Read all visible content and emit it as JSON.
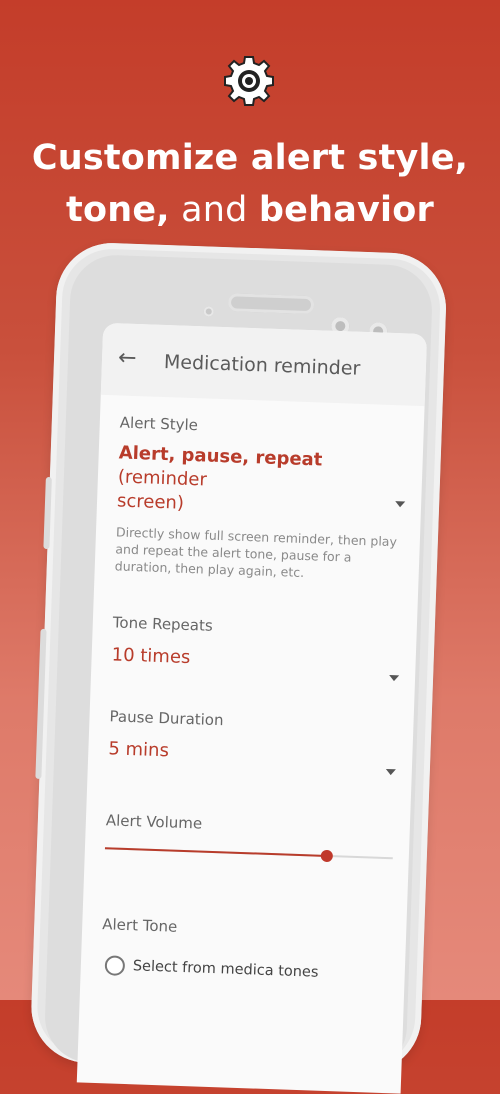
{
  "headline": {
    "line1": "Customize alert style,",
    "line2_bold_a": "tone,",
    "line2_normal": "and",
    "line2_bold_b": "behavior"
  },
  "appbar": {
    "back_icon": "arrow-left-icon",
    "title": "Medication reminder"
  },
  "alert_style": {
    "label": "Alert Style",
    "value_bold": "Alert, pause, repeat",
    "value_rest": " (reminder",
    "value_rest2": "screen)",
    "description": "Directly show full screen reminder, then play and repeat the alert tone, pause for a duration, then play again, etc."
  },
  "tone_repeats": {
    "label": "Tone Repeats",
    "value": "10 times"
  },
  "pause_duration": {
    "label": "Pause Duration",
    "value": "5 mins"
  },
  "alert_volume": {
    "label": "Alert Volume",
    "level": 0.77
  },
  "alert_tone": {
    "label": "Alert Tone",
    "option": "Select from medica tones"
  },
  "colors": {
    "accent": "#b83c2b",
    "background_top": "#c43d2a",
    "background_bottom": "#e5897a"
  },
  "icons": {
    "header_icon": "gear-icon",
    "dropdown_icon": "caret-down-icon"
  }
}
